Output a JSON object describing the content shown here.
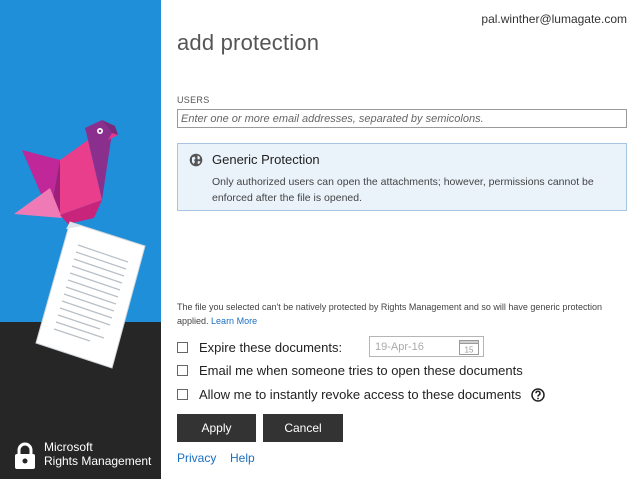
{
  "account": {
    "email": "pal.winther@lumagate.com"
  },
  "title": "add protection",
  "users": {
    "label": "USERS",
    "placeholder": "Enter one or more email addresses, separated by semicolons."
  },
  "protection": {
    "title": "Generic Protection",
    "description": "Only authorized users can open the attachments; however, permissions cannot be enforced after the file is opened."
  },
  "notice": {
    "text": "The file you selected can't be natively protected by Rights Management and so will have generic protection applied.",
    "link": "Learn More"
  },
  "options": {
    "expire_label": "Expire these documents:",
    "expire_date": "19-Apr-16",
    "calendar_day": "15",
    "email_label": "Email me when someone tries to open these documents",
    "revoke_label": "Allow me to instantly revoke access to these documents"
  },
  "buttons": {
    "apply": "Apply",
    "cancel": "Cancel"
  },
  "footer": {
    "privacy": "Privacy",
    "help": "Help"
  },
  "brand": {
    "line1": "Microsoft",
    "line2": "Rights Management"
  },
  "colors": {
    "brand_blue": "#1e8fd8",
    "dark_panel": "#262626",
    "button": "#333333",
    "link": "#1a6fc1",
    "info_bg": "#eaf2fa"
  },
  "icons": [
    "globe-icon",
    "calendar-icon",
    "help-icon",
    "lock-icon",
    "bird-illustration",
    "document-illustration"
  ]
}
